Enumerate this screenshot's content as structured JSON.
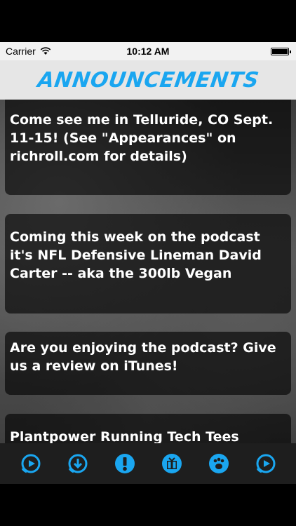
{
  "status_bar": {
    "carrier": "Carrier",
    "time": "10:12 AM"
  },
  "header": {
    "title": "ANNOUNCEMENTS"
  },
  "announcements": [
    {
      "text": "Come see me in Telluride, CO Sept. 11-15! (See \"Appearances\" on richroll.com for details)"
    },
    {
      "text": "Coming this week on the podcast it's NFL Defensive Lineman David Carter -- aka the 300lb Vegan"
    },
    {
      "text": "Are you enjoying the podcast? Give us a review on iTunes!"
    },
    {
      "text": "Plantpower Running Tech Tees"
    }
  ],
  "tab_bar": {
    "accent_color": "#1aa6f0",
    "tabs": [
      {
        "icon": "play-stream-icon"
      },
      {
        "icon": "download-icon"
      },
      {
        "icon": "exclamation-icon"
      },
      {
        "icon": "gift-icon"
      },
      {
        "icon": "paw-icon"
      },
      {
        "icon": "play-circle-icon"
      }
    ]
  }
}
